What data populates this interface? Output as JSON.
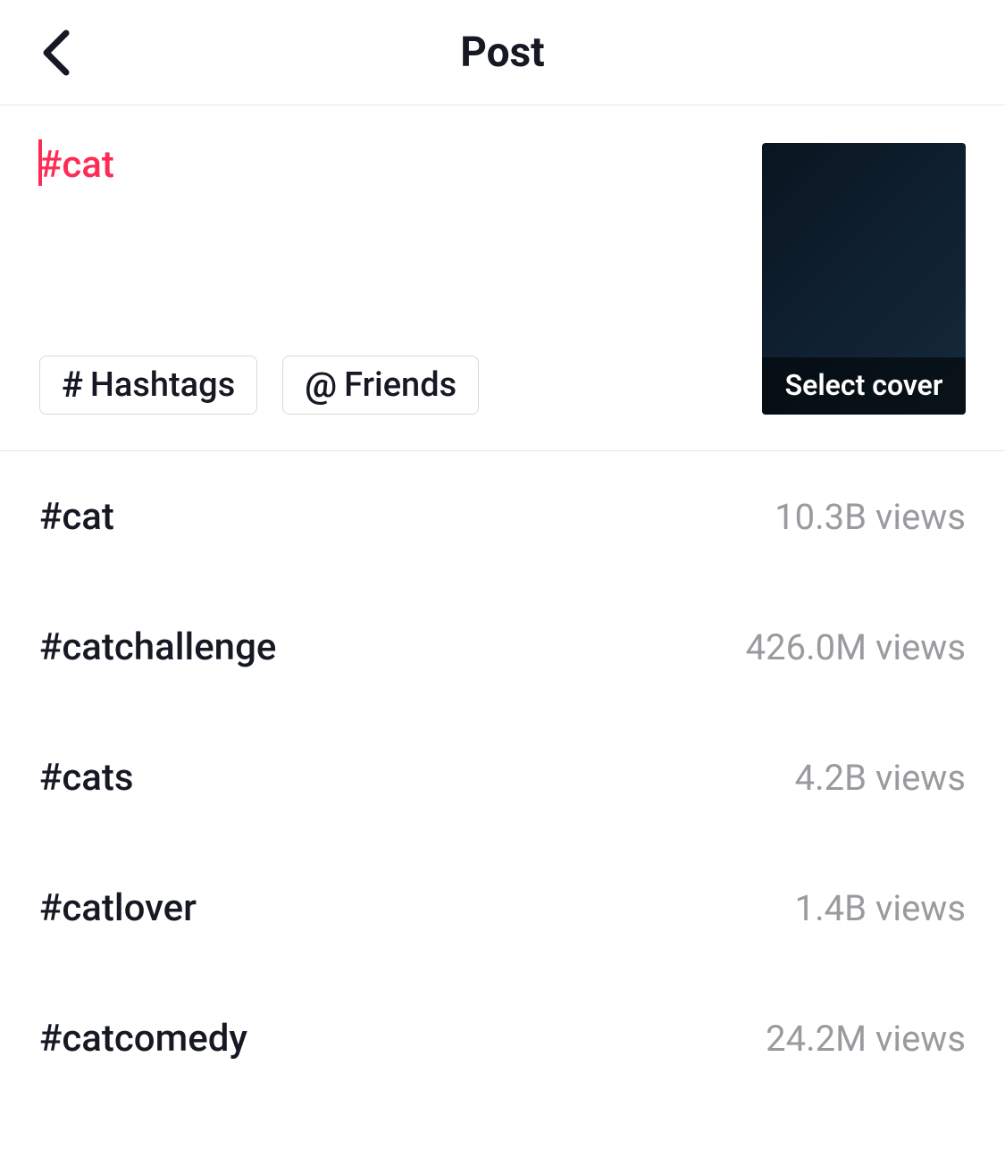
{
  "header": {
    "title": "Post"
  },
  "compose": {
    "caption": "#cat",
    "hashtags_chip": "Hashtags",
    "friends_chip": "Friends",
    "cover_label": "Select cover"
  },
  "suggestions": [
    {
      "tag": "#cat",
      "views": "10.3B views"
    },
    {
      "tag": "#catchallenge",
      "views": "426.0M views"
    },
    {
      "tag": "#cats",
      "views": "4.2B views"
    },
    {
      "tag": "#catlover",
      "views": "1.4B views"
    },
    {
      "tag": "#catcomedy",
      "views": "24.2M views"
    }
  ]
}
